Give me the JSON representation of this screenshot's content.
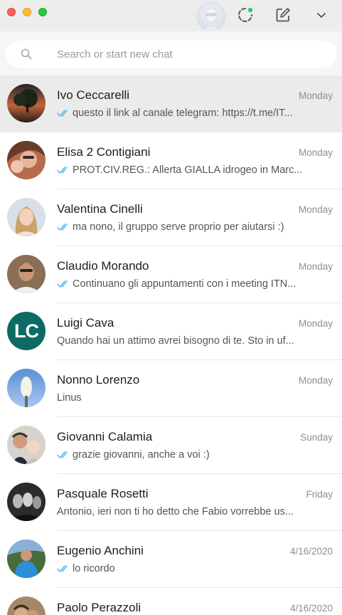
{
  "search": {
    "placeholder": "Search or start new chat"
  },
  "colors": {
    "accent_green": "#25d366",
    "tick_blue": "#4fb6ec",
    "selected_row": "#ebebeb"
  },
  "header": {
    "icons": [
      "profile-avatar",
      "status-icon",
      "new-chat-icon",
      "chevron-down-icon"
    ]
  },
  "chats": [
    {
      "name": "Ivo Ceccarelli",
      "time": "Monday",
      "preview": "questo il link al canale telegram: https://t.me/IT...",
      "ticks": true,
      "selected": true
    },
    {
      "name": "Elisa 2 Contigiani",
      "time": "Monday",
      "preview": "PROT.CIV.REG.: Allerta GIALLA idrogeo in Marc...",
      "ticks": true
    },
    {
      "name": "Valentina Cinelli",
      "time": "Monday",
      "preview": "ma nono, il gruppo serve proprio per aiutarsi :)",
      "ticks": true
    },
    {
      "name": "Claudio Morando",
      "time": "Monday",
      "preview": "Continuano gli appuntamenti con i meeting ITN...",
      "ticks": true
    },
    {
      "name": "Luigi Cava",
      "time": "Monday",
      "preview": "Quando hai un attimo avrei bisogno di te. Sto in uf...",
      "ticks": false,
      "initials": "LC"
    },
    {
      "name": "Nonno Lorenzo",
      "time": "Monday",
      "preview": "Linus",
      "ticks": false
    },
    {
      "name": "Giovanni Calamia",
      "time": "Sunday",
      "preview": "grazie giovanni, anche a voi :)",
      "ticks": true
    },
    {
      "name": "Pasquale Rosetti",
      "time": "Friday",
      "preview": "Antonio, ieri non ti ho detto che Fabio vorrebbe us...",
      "ticks": false
    },
    {
      "name": "Eugenio Anchini",
      "time": "4/16/2020",
      "preview": "lo ricordo",
      "ticks": true
    },
    {
      "name": "Paolo Perazzoli",
      "time": "4/16/2020",
      "preview": "",
      "ticks": false
    }
  ]
}
